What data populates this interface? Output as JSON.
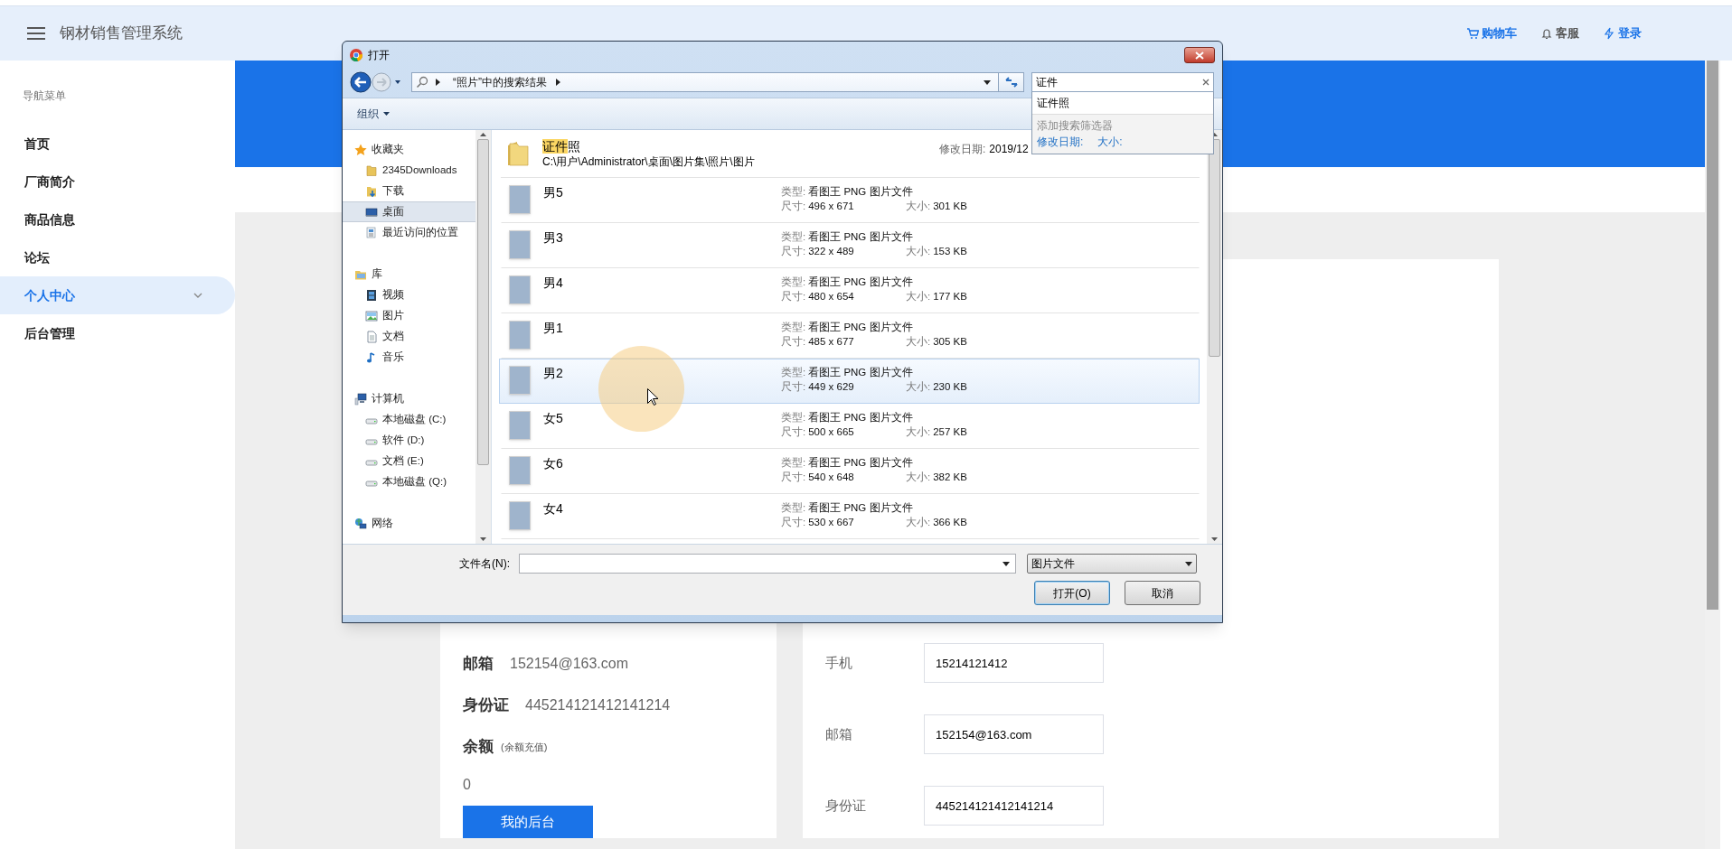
{
  "app": {
    "title": "钢材销售管理系统",
    "header_links": [
      {
        "kind": "cart",
        "label": "购物车"
      },
      {
        "kind": "bell",
        "label": "客服"
      },
      {
        "kind": "bolt",
        "label": "登录"
      }
    ]
  },
  "sidebar": {
    "heading": "导航菜单",
    "items": [
      {
        "label": "首页",
        "selected": false,
        "expandable": false
      },
      {
        "label": "厂商简介",
        "selected": false,
        "expandable": false
      },
      {
        "label": "商品信息",
        "selected": false,
        "expandable": false
      },
      {
        "label": "论坛",
        "selected": false,
        "expandable": false
      },
      {
        "label": "个人中心",
        "selected": true,
        "expandable": true
      },
      {
        "label": "后台管理",
        "selected": false,
        "expandable": false
      }
    ]
  },
  "profile_card": {
    "rows": [
      {
        "label": "邮箱",
        "value": "152154@163.com"
      },
      {
        "label": "身份证",
        "value": "445214121412141214"
      }
    ],
    "balance": {
      "label": "余额",
      "note": "(余额充值)",
      "value": "0"
    },
    "button": "我的后台"
  },
  "edit_form": {
    "fields": [
      {
        "label": "手机",
        "value": "15214121412"
      },
      {
        "label": "邮箱",
        "value": "152154@163.com"
      },
      {
        "label": "身份证",
        "value": "445214121412141214"
      }
    ]
  },
  "dialog": {
    "title": "打开",
    "breadcrumb": "“照片”中的搜索结果",
    "search": {
      "value": "证件",
      "suggestion": "证件照",
      "filter_heading": "添加搜索筛选器",
      "filters": [
        "修改日期:",
        "大小:"
      ]
    },
    "toolbar": "组织",
    "nav": [
      {
        "label": "收藏夹",
        "kind": "star",
        "selected": false,
        "children": [
          {
            "label": "2345Downloads",
            "kind": "folder",
            "selected": false
          },
          {
            "label": "下载",
            "kind": "download",
            "selected": false
          },
          {
            "label": "桌面",
            "kind": "desktop",
            "selected": true
          },
          {
            "label": "最近访问的位置",
            "kind": "recent",
            "selected": false
          }
        ]
      },
      {
        "label": "库",
        "kind": "library",
        "selected": false,
        "children": [
          {
            "label": "视频",
            "kind": "film",
            "selected": false
          },
          {
            "label": "图片",
            "kind": "picture",
            "selected": false
          },
          {
            "label": "文档",
            "kind": "document",
            "selected": false
          },
          {
            "label": "音乐",
            "kind": "music",
            "selected": false
          }
        ]
      },
      {
        "label": "计算机",
        "kind": "computer",
        "selected": false,
        "children": [
          {
            "label": "本地磁盘 (C:)",
            "kind": "drive",
            "selected": false
          },
          {
            "label": "软件 (D:)",
            "kind": "drive",
            "selected": false
          },
          {
            "label": "文档 (E:)",
            "kind": "drive",
            "selected": false
          },
          {
            "label": "本地磁盘 (Q:)",
            "kind": "drive",
            "selected": false
          }
        ]
      },
      {
        "label": "网络",
        "kind": "network",
        "selected": false
      }
    ],
    "folder": {
      "name_parts": [
        {
          "text": "证件",
          "highlighted": true
        },
        {
          "text": "照",
          "highlighted": false
        }
      ],
      "path": "C:\\用户\\Administrator\\桌面\\图片集\\照片\\图片",
      "date_label": "修改日期:",
      "date": "2019/12"
    },
    "files": [
      {
        "name": "男5",
        "type_label": "类型:",
        "type": "看图王 PNG 图片文件",
        "dims_label": "尺寸:",
        "dims": "496 x 671",
        "size_label": "大小:",
        "size": "301 KB",
        "selected": false
      },
      {
        "name": "男3",
        "type_label": "类型:",
        "type": "看图王 PNG 图片文件",
        "dims_label": "尺寸:",
        "dims": "322 x 489",
        "size_label": "大小:",
        "size": "153 KB",
        "selected": false
      },
      {
        "name": "男4",
        "type_label": "类型:",
        "type": "看图王 PNG 图片文件",
        "dims_label": "尺寸:",
        "dims": "480 x 654",
        "size_label": "大小:",
        "size": "177 KB",
        "selected": false
      },
      {
        "name": "男1",
        "type_label": "类型:",
        "type": "看图王 PNG 图片文件",
        "dims_label": "尺寸:",
        "dims": "485 x 677",
        "size_label": "大小:",
        "size": "305 KB",
        "selected": false
      },
      {
        "name": "男2",
        "type_label": "类型:",
        "type": "看图王 PNG 图片文件",
        "dims_label": "尺寸:",
        "dims": "449 x 629",
        "size_label": "大小:",
        "size": "230 KB",
        "selected": true
      },
      {
        "name": "女5",
        "type_label": "类型:",
        "type": "看图王 PNG 图片文件",
        "dims_label": "尺寸:",
        "dims": "500 x 665",
        "size_label": "大小:",
        "size": "257 KB",
        "selected": false
      },
      {
        "name": "女6",
        "type_label": "类型:",
        "type": "看图王 PNG 图片文件",
        "dims_label": "尺寸:",
        "dims": "540 x 648",
        "size_label": "大小:",
        "size": "382 KB",
        "selected": false
      },
      {
        "name": "女4",
        "type_label": "类型:",
        "type": "看图王 PNG 图片文件",
        "dims_label": "尺寸:",
        "dims": "530 x 667",
        "size_label": "大小:",
        "size": "366 KB",
        "selected": false
      }
    ],
    "filename_label": "文件名(N):",
    "filter": "图片文件",
    "buttons": [
      {
        "label": "打开(O)",
        "default": true
      },
      {
        "label": "取消",
        "default": false
      }
    ]
  }
}
